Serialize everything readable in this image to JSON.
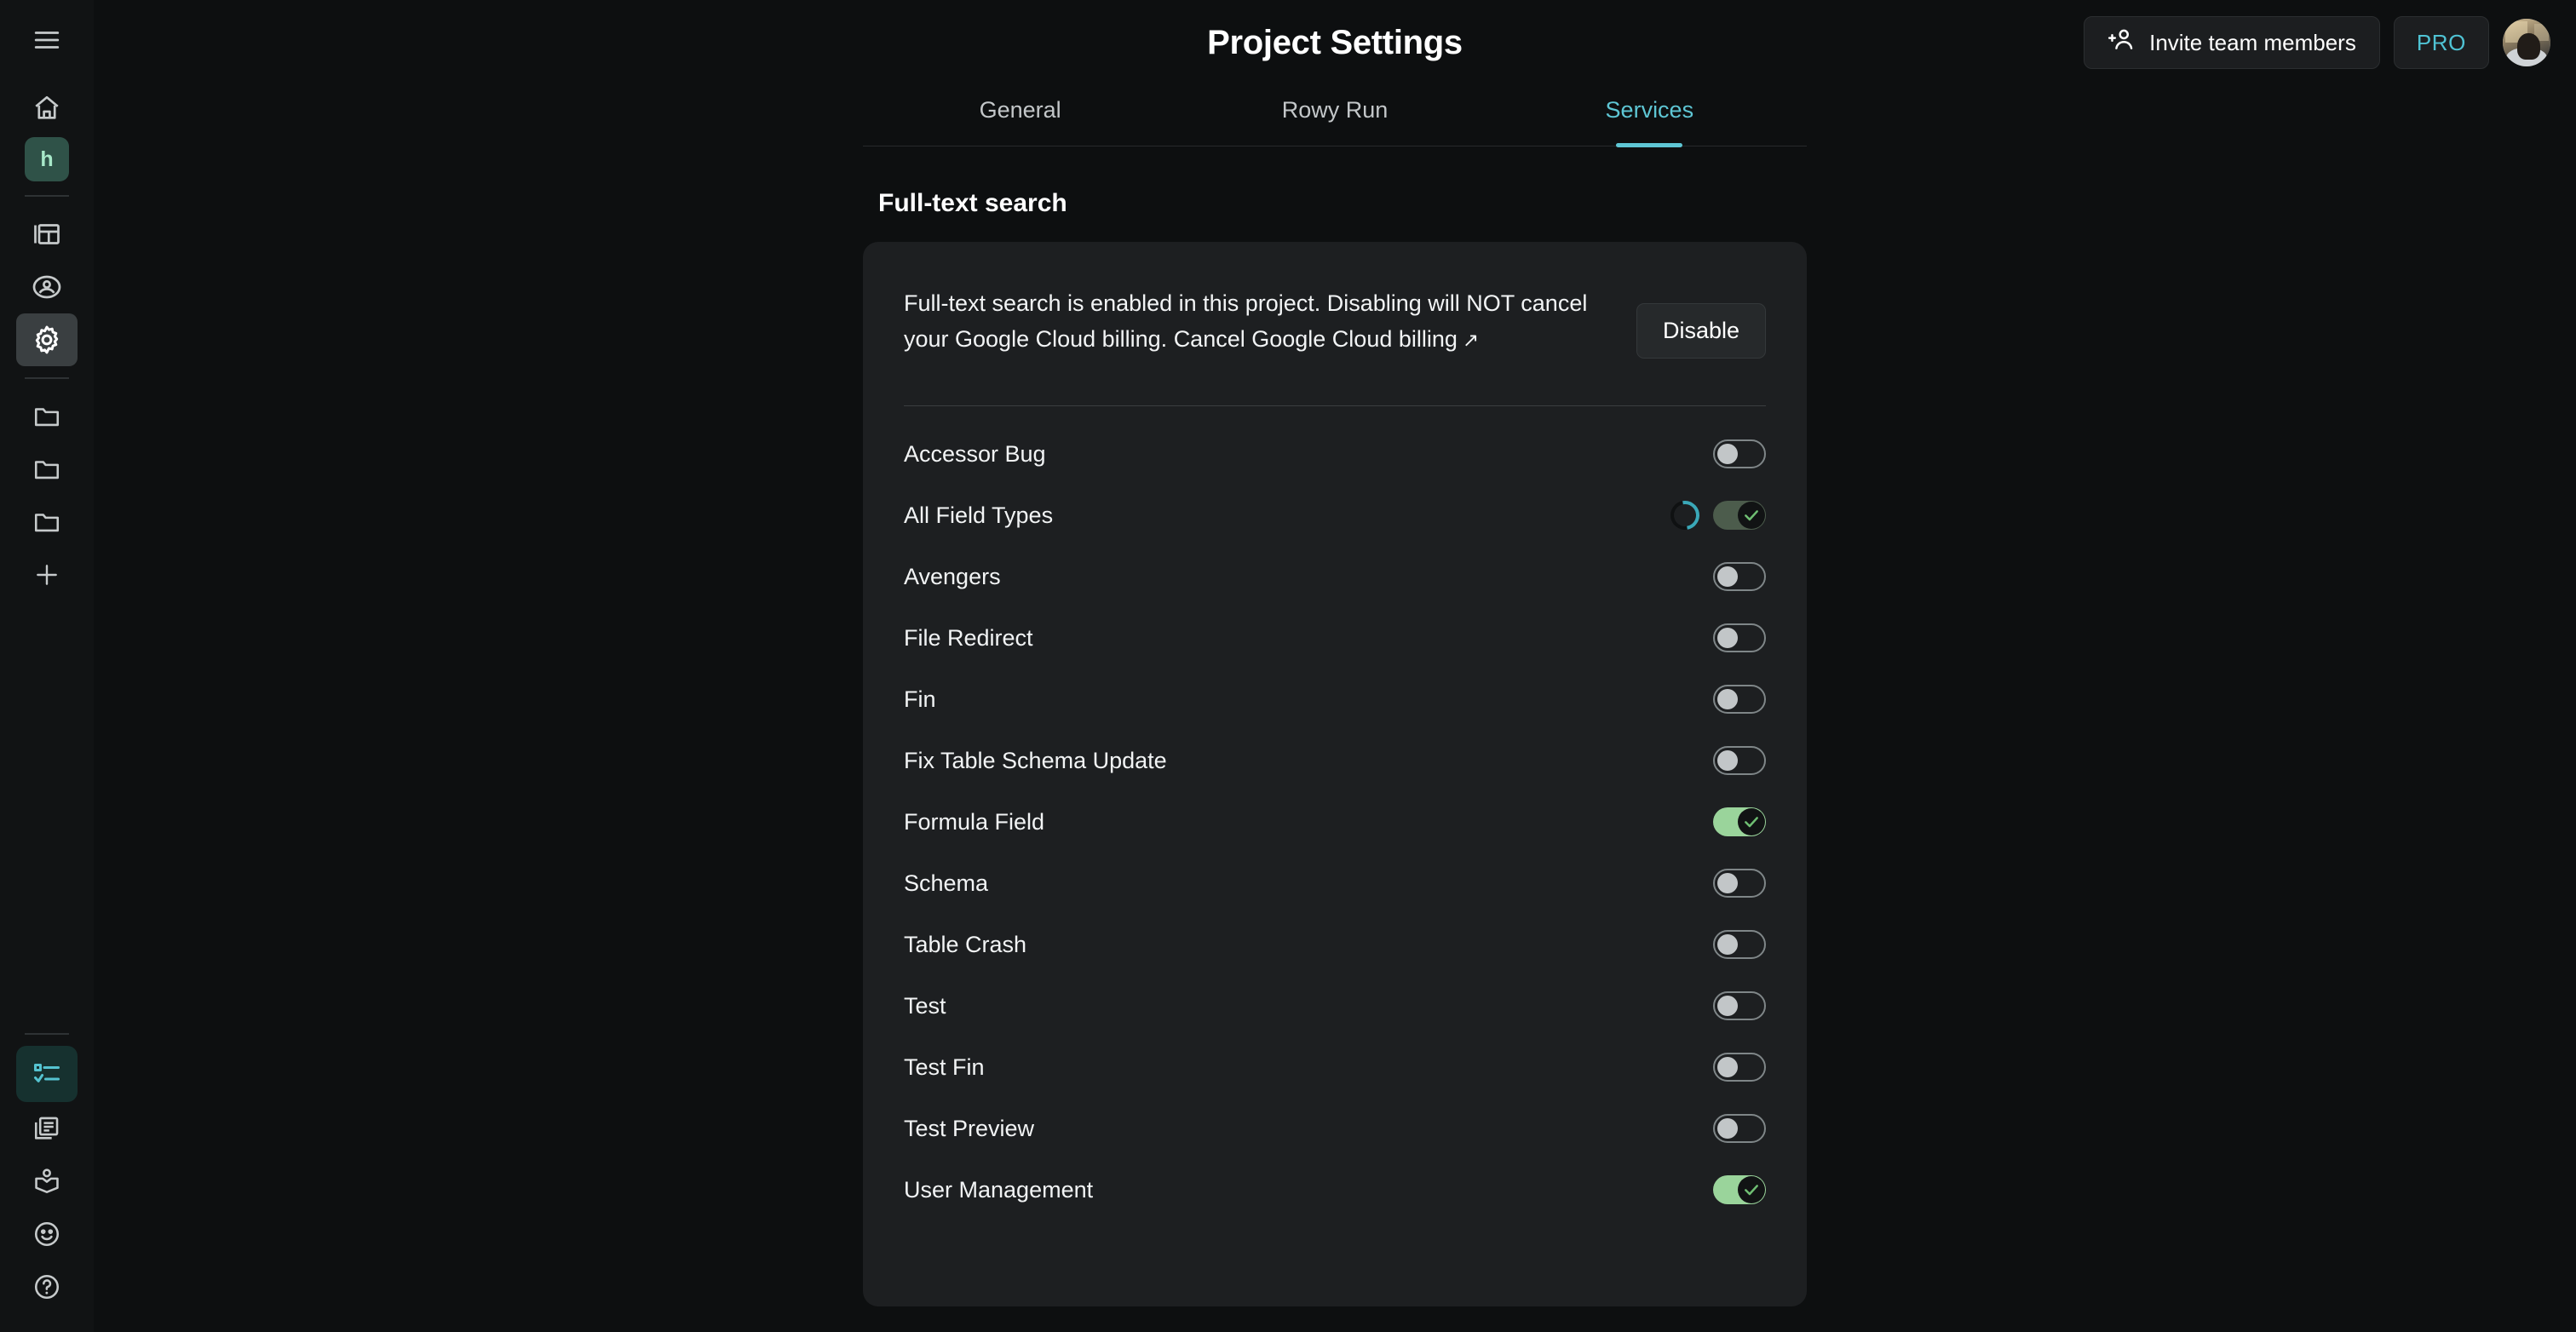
{
  "sidebar": {
    "menu_icon": "hamburger-menu-icon",
    "items": [
      {
        "name": "home",
        "icon": "home-icon",
        "label": "Home",
        "state": "normal"
      },
      {
        "name": "project-logo",
        "icon": "project-initial",
        "label": "h",
        "state": "logo"
      },
      {
        "name": "tables",
        "icon": "table-icon",
        "label": "Tables",
        "state": "normal"
      },
      {
        "name": "user-account",
        "icon": "account-circle-icon",
        "label": "Account",
        "state": "normal"
      },
      {
        "name": "project-settings",
        "icon": "gear-icon",
        "label": "Project Settings",
        "state": "active"
      },
      {
        "name": "folder-1",
        "icon": "folder-icon",
        "label": "Folder",
        "state": "normal"
      },
      {
        "name": "folder-2",
        "icon": "folder-icon",
        "label": "Folder",
        "state": "normal"
      },
      {
        "name": "folder-3",
        "icon": "folder-icon",
        "label": "Folder",
        "state": "normal"
      },
      {
        "name": "add-table",
        "icon": "plus-icon",
        "label": "Add",
        "state": "normal"
      }
    ],
    "bottom_items": [
      {
        "name": "task-list",
        "icon": "checklist-icon",
        "label": "Tasks",
        "state": "active-teal"
      },
      {
        "name": "docs",
        "icon": "documents-icon",
        "label": "Docs",
        "state": "normal"
      },
      {
        "name": "learn",
        "icon": "book-person-icon",
        "label": "Learn",
        "state": "normal"
      },
      {
        "name": "feedback",
        "icon": "smiley-icon",
        "label": "Feedback",
        "state": "normal"
      },
      {
        "name": "help",
        "icon": "question-circle-icon",
        "label": "Help",
        "state": "normal"
      }
    ]
  },
  "header": {
    "title": "Project Settings",
    "invite_label": "Invite team members",
    "invite_icon": "person-add-icon",
    "plan_badge": "PRO",
    "avatar_alt": "User avatar"
  },
  "tabs": [
    {
      "label": "General",
      "active": false
    },
    {
      "label": "Rowy Run",
      "active": false
    },
    {
      "label": "Services",
      "active": true
    }
  ],
  "section": {
    "title": "Full-text search",
    "notice_text": "Full-text search is enabled in this project. Disabling will NOT cancel your Google Cloud billing. ",
    "notice_link": "Cancel Google Cloud billing",
    "notice_link_icon": "external-link-arrow-icon",
    "disable_label": "Disable"
  },
  "services": [
    {
      "label": "Accessor Bug",
      "enabled": false,
      "loading": false
    },
    {
      "label": "All Field Types",
      "enabled": true,
      "loading": true
    },
    {
      "label": "Avengers",
      "enabled": false,
      "loading": false
    },
    {
      "label": "File Redirect",
      "enabled": false,
      "loading": false
    },
    {
      "label": "Fin",
      "enabled": false,
      "loading": false
    },
    {
      "label": "Fix Table Schema Update",
      "enabled": false,
      "loading": false
    },
    {
      "label": "Formula Field",
      "enabled": true,
      "loading": false
    },
    {
      "label": "Schema",
      "enabled": false,
      "loading": false
    },
    {
      "label": "Table Crash",
      "enabled": false,
      "loading": false
    },
    {
      "label": "Test",
      "enabled": false,
      "loading": false
    },
    {
      "label": "Test Fin",
      "enabled": false,
      "loading": false
    },
    {
      "label": "Test Preview",
      "enabled": false,
      "loading": false
    },
    {
      "label": "User Management",
      "enabled": true,
      "loading": false
    }
  ],
  "colors": {
    "page_bg": "#0d0f10",
    "sidebar_bg": "#111314",
    "card_bg": "#1d1f21",
    "accent_teal": "#5ec6d4",
    "toggle_on_green": "#9ad49b",
    "logo_green_bg": "#2f5248",
    "logo_text": "#a7e8c9"
  }
}
